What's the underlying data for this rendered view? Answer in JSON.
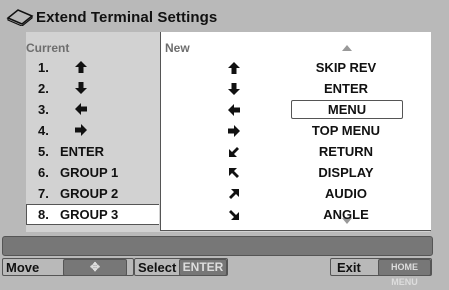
{
  "title": "Extend Terminal Settings",
  "current_header": "Current",
  "new_header": "New",
  "current": [
    {
      "num": "1.",
      "label": "",
      "icon": "up-arrow-icon"
    },
    {
      "num": "2.",
      "label": "",
      "icon": "down-arrow-icon"
    },
    {
      "num": "3.",
      "label": "",
      "icon": "left-arrow-icon"
    },
    {
      "num": "4.",
      "label": "",
      "icon": "right-arrow-icon"
    },
    {
      "num": "5.",
      "label": "ENTER"
    },
    {
      "num": "6.",
      "label": "GROUP  1"
    },
    {
      "num": "7.",
      "label": "GROUP  2"
    },
    {
      "num": "8.",
      "label": "GROUP  3",
      "selected": true
    }
  ],
  "new": [
    {
      "icon": "up-arrow-icon",
      "label": "SKIP REV"
    },
    {
      "icon": "down-arrow-icon",
      "label": "ENTER"
    },
    {
      "icon": "left-arrow-icon",
      "label": "MENU",
      "selected": true
    },
    {
      "icon": "right-arrow-icon",
      "label": "TOP MENU"
    },
    {
      "icon": "down-left-arrow-icon",
      "label": "RETURN"
    },
    {
      "icon": "up-left-arrow-icon",
      "label": "DISPLAY"
    },
    {
      "icon": "up-right-arrow-icon",
      "label": "AUDIO"
    },
    {
      "icon": "down-right-arrow-icon",
      "label": "ANGLE"
    }
  ],
  "footer": {
    "move_label": "Move",
    "move_button": "✥",
    "select_label": "Select",
    "select_button": "ENTER",
    "exit_label": "Exit",
    "exit_button": "HOME MENU"
  }
}
